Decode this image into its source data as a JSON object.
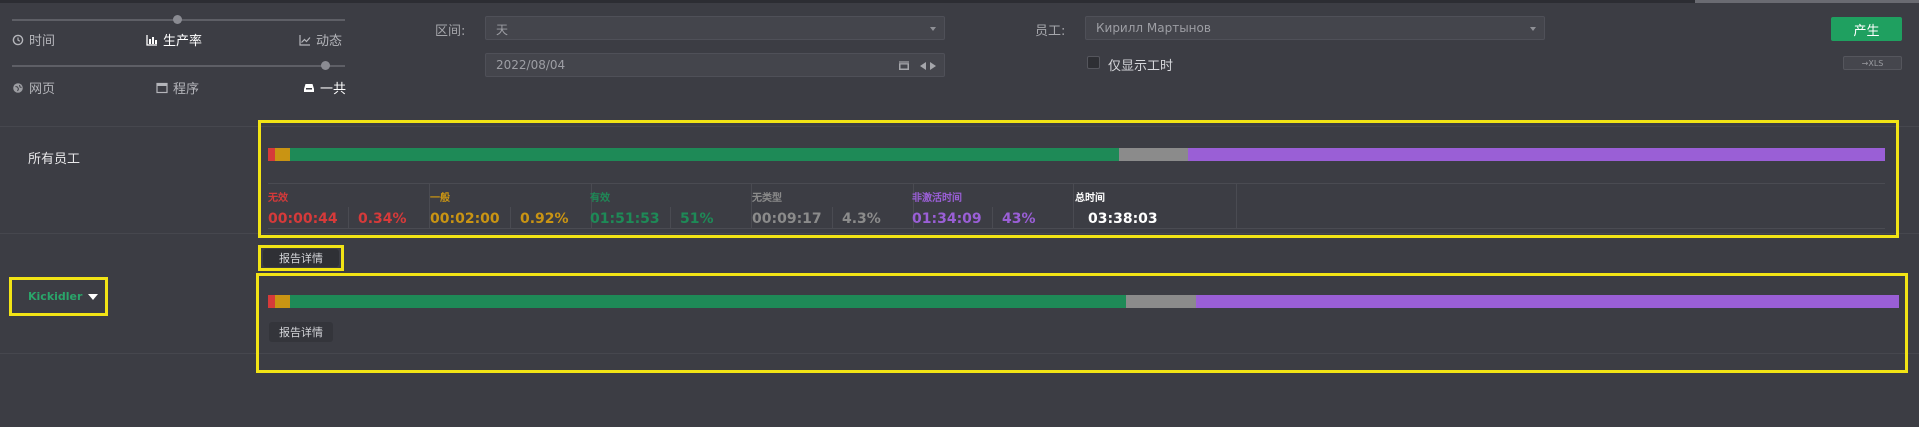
{
  "colors": {
    "unproductive": "#d63a3a",
    "neutral": "#c99413",
    "productive": "#1e8a57",
    "untyped": "#8b8b8b",
    "inactive": "#9a5fd6",
    "total": "#ffffff",
    "highlight": "#f2e415",
    "accent_button": "#1fa060"
  },
  "controls": {
    "row1": [
      {
        "label": "时间",
        "icon": "clock-icon",
        "active": false
      },
      {
        "label": "生产率",
        "icon": "bar-chart-icon",
        "active": true
      },
      {
        "label": "动态",
        "icon": "line-chart-icon",
        "active": false
      }
    ],
    "row2": [
      {
        "label": "网页",
        "icon": "globe-icon",
        "active": false
      },
      {
        "label": "程序",
        "icon": "window-icon",
        "active": false
      },
      {
        "label": "一共",
        "icon": "inbox-icon",
        "active": true
      }
    ]
  },
  "filters": {
    "interval_label": "区间:",
    "interval_value": "天",
    "date_value": "2022/08/04",
    "employee_label": "员工:",
    "employee_value": "Кирилл Мартынов",
    "only_work_hours_label": "仅显示工时",
    "generate_label": "产生",
    "export_label": "→XLS"
  },
  "summary": {
    "row_label": "所有员工",
    "details_label": "报告详情",
    "bar": [
      {
        "key": "unproductive",
        "pct": 0.34
      },
      {
        "key": "neutral",
        "pct": 0.92
      },
      {
        "key": "productive",
        "pct": 51
      },
      {
        "key": "untyped",
        "pct": 4.3
      },
      {
        "key": "inactive",
        "pct": 43
      }
    ],
    "stats": [
      {
        "key": "unproductive",
        "head": "无效",
        "time": "00:00:44",
        "pct": "0.34%"
      },
      {
        "key": "neutral",
        "head": "一般",
        "time": "00:02:00",
        "pct": "0.92%"
      },
      {
        "key": "productive",
        "head": "有效",
        "time": "01:51:53",
        "pct": "51%"
      },
      {
        "key": "untyped",
        "head": "无类型",
        "time": "00:09:17",
        "pct": "4.3%"
      },
      {
        "key": "inactive",
        "head": "非激活时间",
        "time": "01:34:09",
        "pct": "43%"
      },
      {
        "key": "total",
        "head": "总时间",
        "time": "03:38:03",
        "pct": ""
      }
    ]
  },
  "group": {
    "name": "Kickidler",
    "details_label": "报告详情",
    "bar": [
      {
        "key": "unproductive",
        "pct": 0.34
      },
      {
        "key": "neutral",
        "pct": 0.92
      },
      {
        "key": "productive",
        "pct": 51
      },
      {
        "key": "untyped",
        "pct": 4.3
      },
      {
        "key": "inactive",
        "pct": 43
      }
    ]
  }
}
